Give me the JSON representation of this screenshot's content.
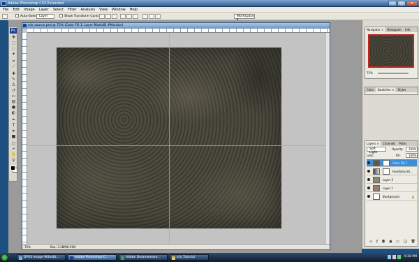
{
  "window": {
    "title": "Adobe Photoshop CS3 Extended"
  },
  "menu": {
    "items": [
      "File",
      "Edit",
      "Image",
      "Layer",
      "Select",
      "Filter",
      "Analysis",
      "View",
      "Window",
      "Help"
    ]
  },
  "options": {
    "auto_select_label": "Auto-Select:",
    "auto_select_value": "Layer",
    "transform_label": "Show Transform Controls",
    "workspace_label": "Workspace ▾"
  },
  "toolbox": {
    "logo": "Ps"
  },
  "document": {
    "title": "srb_source.psd @ 75% (Color Fill 1, Layer Mask/8) #Monitor)",
    "zoom": "75%",
    "doc_info": "Doc: 3.38M/8.91M"
  },
  "navigator": {
    "tabs": [
      "Navigator ×",
      "Histogram",
      "Info"
    ],
    "zoom": "75%"
  },
  "color_panel": {
    "tabs": [
      "Color",
      "Swatches ×",
      "Styles"
    ]
  },
  "layers_panel": {
    "tabs": [
      "Layers ×",
      "Channels",
      "Paths"
    ],
    "blend_mode": "Soft Light",
    "opacity_label": "Opacity:",
    "opacity_value": "100%",
    "lock_label": "Lock:",
    "fill_label": "Fill:",
    "fill_value": "100%",
    "layers": [
      {
        "name": "Color Fill 1",
        "selected": true
      },
      {
        "name": "Hue/Saturati...",
        "selected": false
      },
      {
        "name": "Layer 3",
        "selected": false
      },
      {
        "name": "Layer 1",
        "selected": false
      },
      {
        "name": "Background",
        "selected": false
      }
    ]
  },
  "taskbar": {
    "items": [
      {
        "label": "DPXS Image 900x48...",
        "active": false
      },
      {
        "label": "Adobe Photoshop C...",
        "active": true
      },
      {
        "label": "Adobe Dreamweave...",
        "active": false
      },
      {
        "label": "srb_Tutorial",
        "active": false
      }
    ],
    "clock": "9:28 PM"
  }
}
